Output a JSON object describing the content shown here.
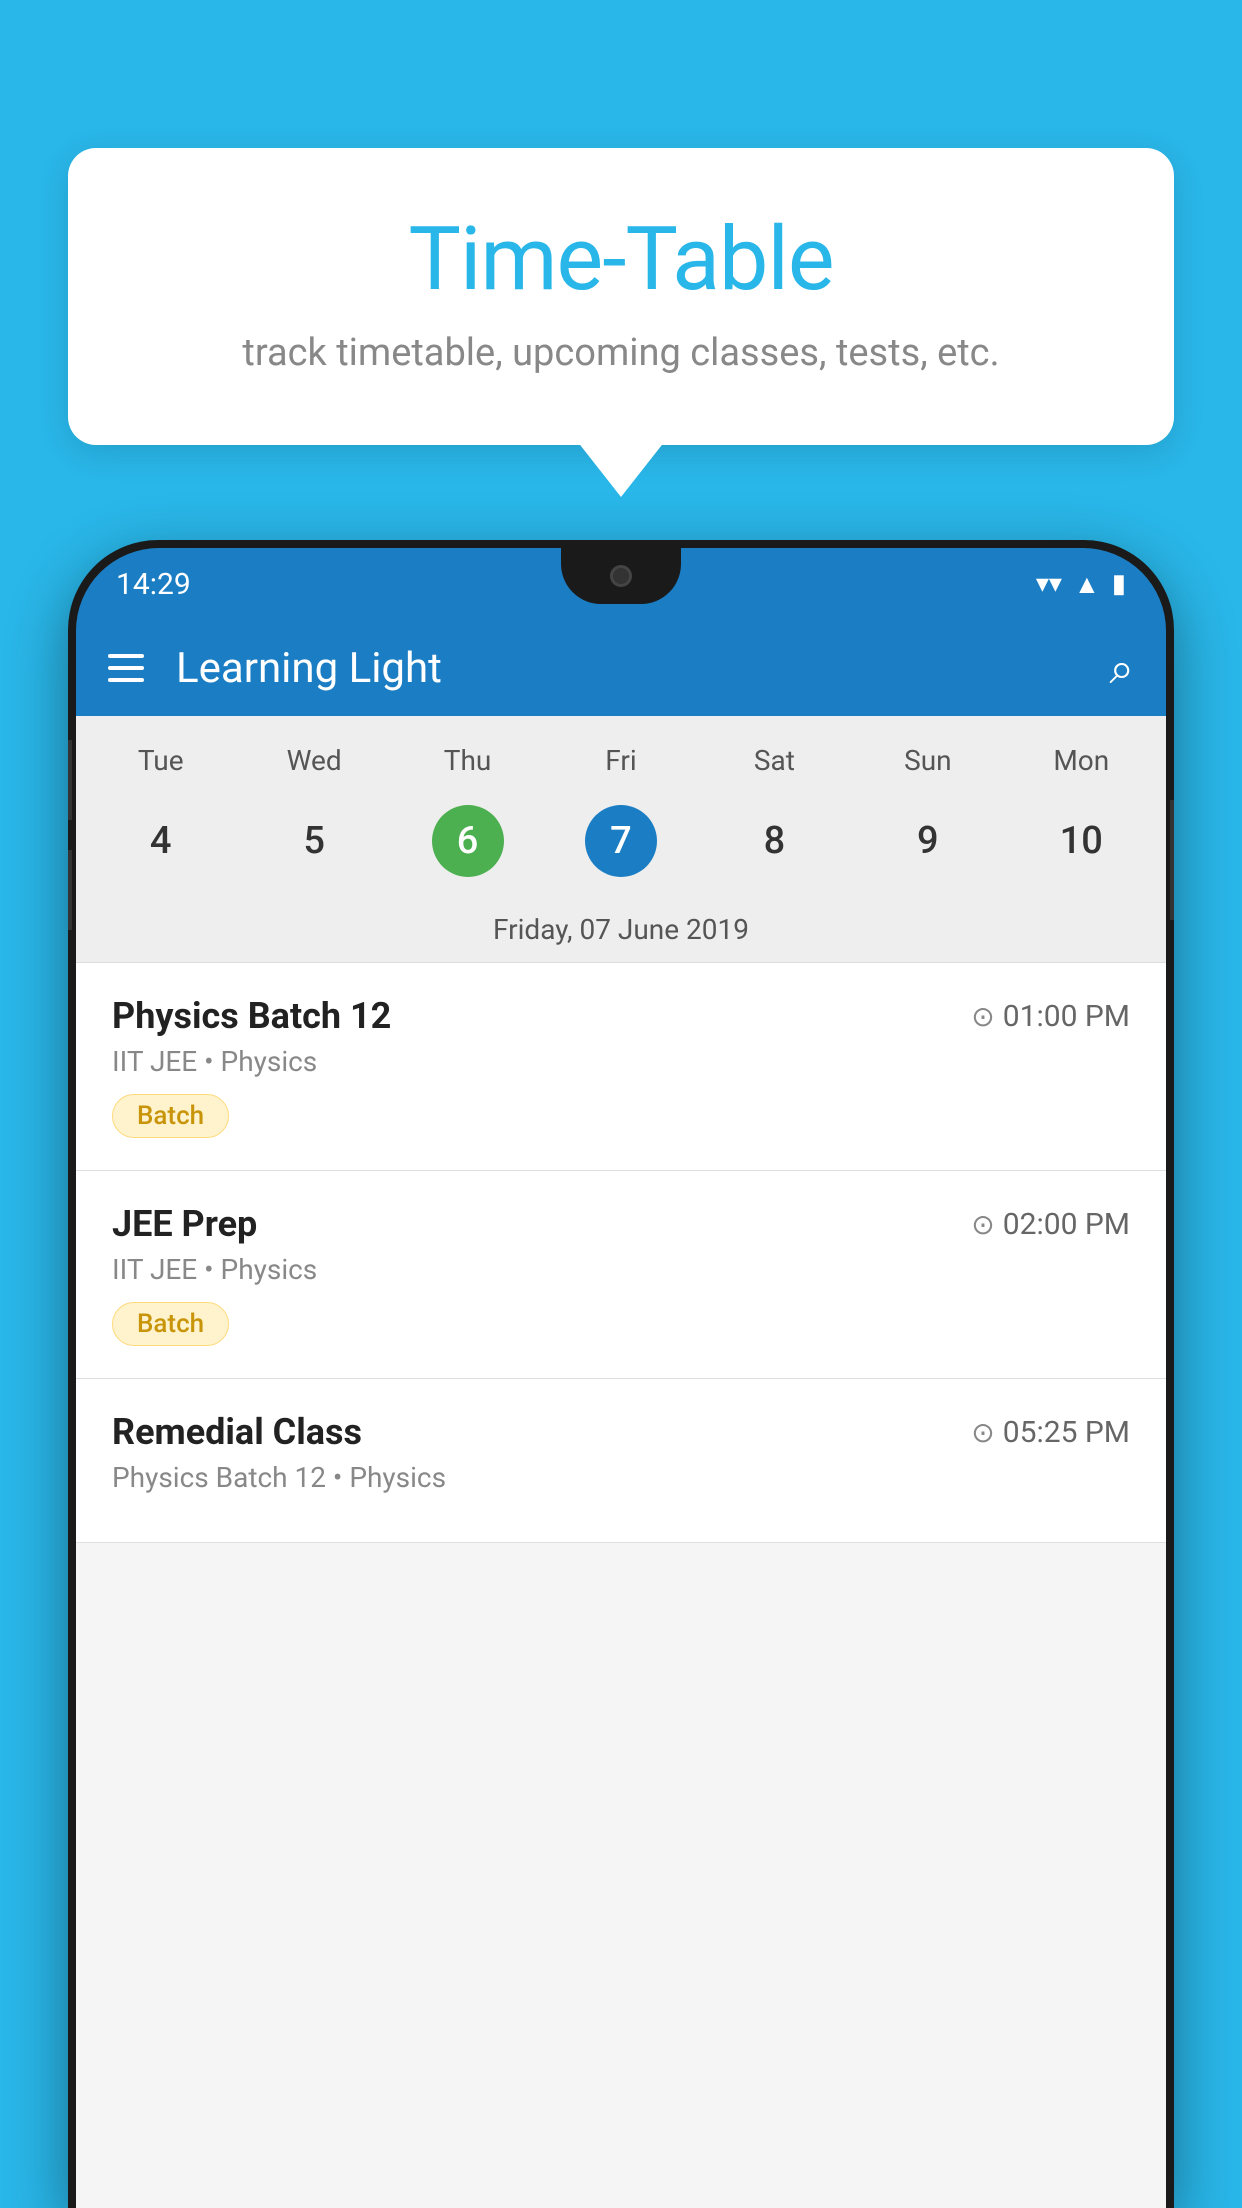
{
  "background_color": "#29b6e8",
  "bubble": {
    "title": "Time-Table",
    "subtitle": "track timetable, upcoming classes, tests, etc."
  },
  "phone": {
    "status_bar": {
      "time": "14:29"
    },
    "app_bar": {
      "title": "Learning Light"
    },
    "calendar": {
      "day_headers": [
        "Tue",
        "Wed",
        "Thu",
        "Fri",
        "Sat",
        "Sun",
        "Mon"
      ],
      "day_numbers": [
        "4",
        "5",
        "6",
        "7",
        "8",
        "9",
        "10"
      ],
      "today": "6",
      "selected": "7",
      "selected_date_label": "Friday, 07 June 2019"
    },
    "schedule": [
      {
        "title": "Physics Batch 12",
        "time": "01:00 PM",
        "subtitle": "IIT JEE • Physics",
        "tag": "Batch"
      },
      {
        "title": "JEE Prep",
        "time": "02:00 PM",
        "subtitle": "IIT JEE • Physics",
        "tag": "Batch"
      },
      {
        "title": "Remedial Class",
        "time": "05:25 PM",
        "subtitle": "Physics Batch 12 • Physics",
        "tag": ""
      }
    ]
  }
}
